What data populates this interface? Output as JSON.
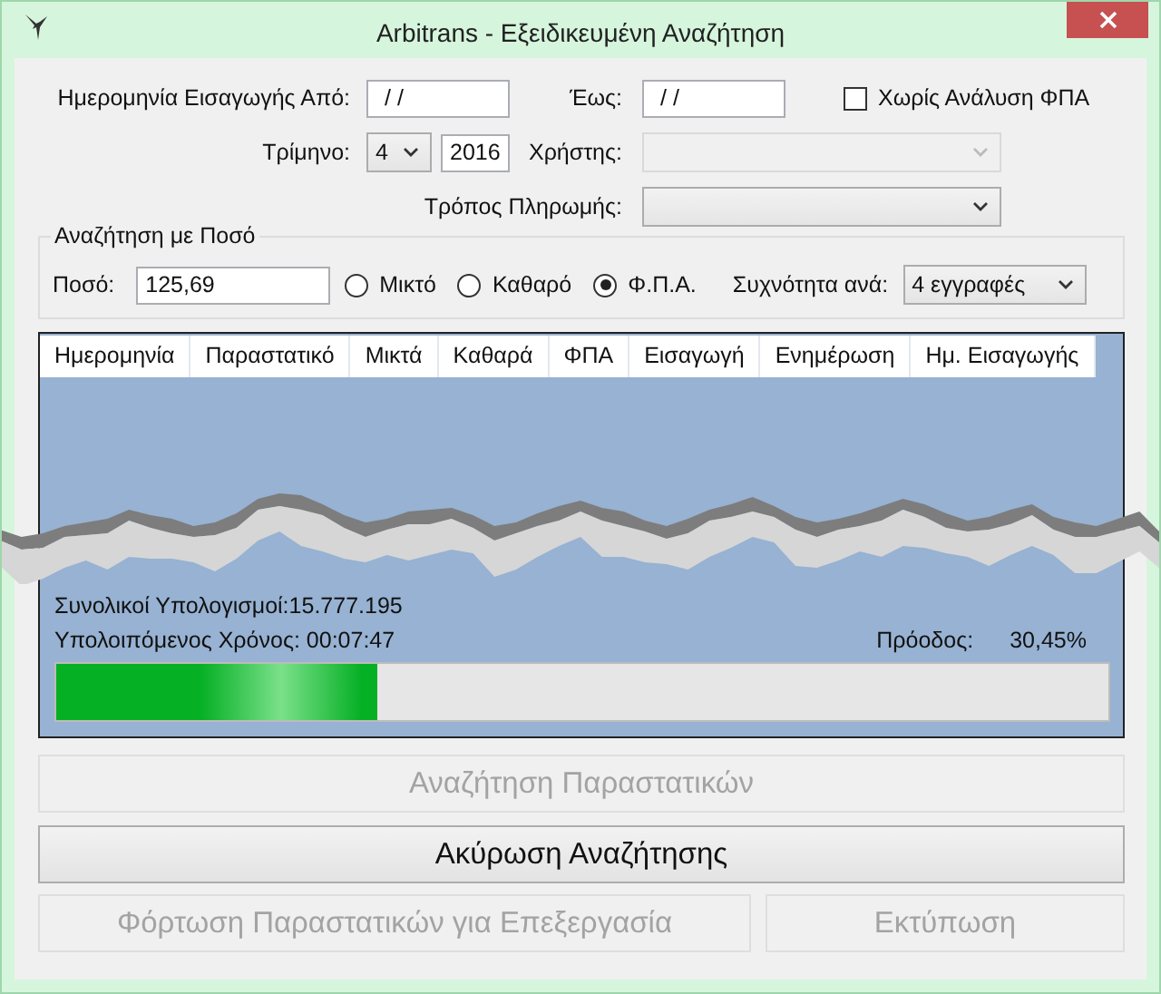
{
  "window": {
    "title": "Arbitrans - Εξειδικευμένη Αναζήτηση"
  },
  "filters": {
    "date_from": {
      "label": "Ημερομηνία Εισαγωγής Από:",
      "value": "/ /"
    },
    "date_to": {
      "label": "Έως:",
      "value": "/ /"
    },
    "no_vat_split": {
      "label": "Χωρίς Ανάλυση ΦΠΑ",
      "checked": false
    },
    "quarter": {
      "label": "Τρίμηνο:",
      "value": "4"
    },
    "year": {
      "value": "2016"
    },
    "user": {
      "label": "Χρήστης:",
      "disabled": true
    },
    "payment": {
      "label": "Τρόπος Πληρωμής:",
      "disabled": false
    }
  },
  "amount_search": {
    "title": "Αναζήτηση με Ποσό",
    "amount_label": "Ποσό:",
    "amount": "125,69",
    "options": [
      {
        "label": "Μικτό",
        "selected": false
      },
      {
        "label": "Καθαρό",
        "selected": false
      },
      {
        "label": "Φ.Π.Α.",
        "selected": true
      }
    ],
    "frequency_label": "Συχνότητα ανά:",
    "frequency": "4 εγγραφές"
  },
  "table": {
    "columns": [
      "Ημερομηνία",
      "Παραστατικό",
      "Μικτά",
      "Καθαρά",
      "ΦΠΑ",
      "Εισαγωγή",
      "Ενημέρωση",
      "Ημ. Εισαγωγής"
    ]
  },
  "progress": {
    "totals": "Συνολικοί Υπολογισμοί:15.777.195",
    "remaining": "Υπολοιπόμενος Χρόνος: 00:07:47",
    "label": "Πρόοδος:",
    "percent": "30,45%",
    "level": 0.3045
  },
  "buttons": [
    {
      "label": "Αναζήτηση Παραστατικών",
      "disabled": true
    },
    {
      "label": "Ακύρωση Αναζήτησης",
      "disabled": false
    },
    {
      "label": "Φόρτωση Παραστατικών για Επεξεργασία",
      "disabled": true
    },
    {
      "label": "Εκτύπωση",
      "disabled": true
    }
  ]
}
